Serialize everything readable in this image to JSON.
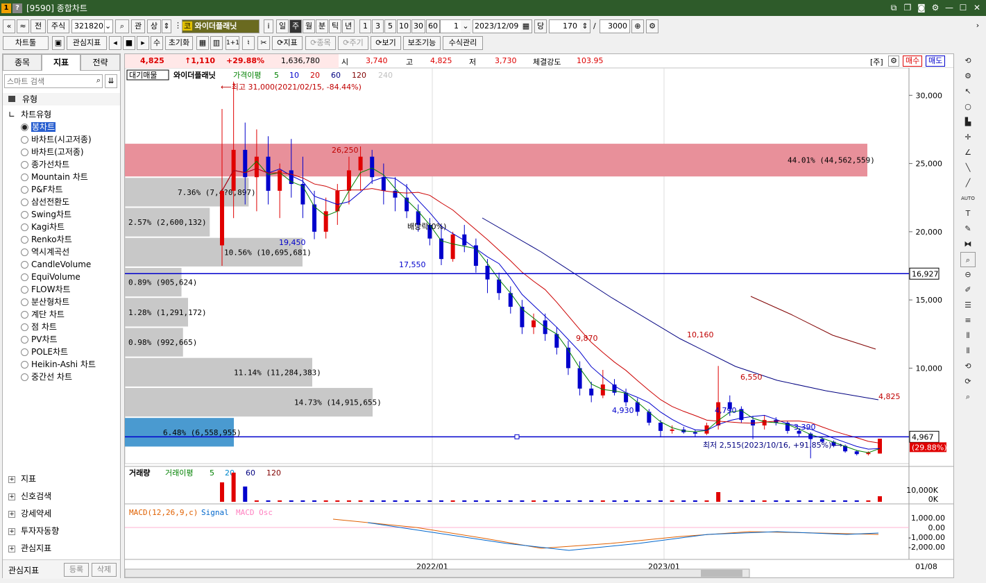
{
  "window": {
    "title": "[9590] 종합차트",
    "icons": [
      "gold-1-icon",
      "question-icon"
    ]
  },
  "toolbar1": {
    "nav_first": "«",
    "nav_up": "≈",
    "prev_label": "전",
    "type_label": "주식",
    "code": "321820",
    "search": "⌕",
    "gwan": "관",
    "sang": "상",
    "market_badge": "코",
    "stock_name": "와이더플래닛",
    "info": "i",
    "periods": [
      "일",
      "주",
      "월",
      "분",
      "틱",
      "년"
    ],
    "active_period": "주",
    "intervals": [
      "1",
      "3",
      "5",
      "10",
      "30",
      "60"
    ],
    "interval_value": "1",
    "date": "2023/12/09",
    "dang": "당",
    "count": "170",
    "slash": "/",
    "max": "3000"
  },
  "toolbar2": {
    "chart_tool": "차트툴",
    "watch_indicator": "관심지표",
    "su": "수",
    "reset": "초기화",
    "one_plus_one": "1+1",
    "indicator": "지표",
    "item": "종목",
    "period": "주기",
    "view": "보기",
    "sub_func": "보조기능",
    "formula": "수식관리"
  },
  "left_panel": {
    "tabs": [
      "종목",
      "지표",
      "전략"
    ],
    "active_tab": "지표",
    "search_placeholder": "스마트 검색",
    "group_label": "유형",
    "subgroup_label": "차트유형",
    "chart_types": [
      "봉차트",
      "바차트(시고저종)",
      "바차트(고저종)",
      "종가선차트",
      "Mountain 차트",
      "P&F차트",
      "삼선전환도",
      "Swing차트",
      "Kagi차트",
      "Renko차트",
      "역시계곡선",
      "CandleVolume",
      "EquiVolume",
      "FLOW차트",
      "분산형차트",
      "계단 차트",
      "점 차트",
      "PV차트",
      "POLE차트",
      "Heikin-Ashi 차트",
      "중간선 차트"
    ],
    "selected_type": "봉차트",
    "bottom_items": [
      "지표",
      "신호검색",
      "강세약세",
      "투자자동향",
      "관심지표"
    ],
    "footer_label": "관심지표",
    "register": "등록",
    "delete": "삭제"
  },
  "price_bar": {
    "price": "4,825",
    "change": "↑1,110",
    "pct": "+29.88%",
    "volume": "1,636,780",
    "open_label": "시",
    "open": "3,740",
    "high_label": "고",
    "high": "4,825",
    "low_label": "저",
    "low": "3,730",
    "strength_label": "체결강도",
    "strength": "103.95",
    "ju": "[주]",
    "buy": "매수",
    "sell": "매도"
  },
  "chart_data": {
    "type": "candlestick",
    "legend_main": {
      "vol_profile": "대기매물",
      "name": "와이더플래닛",
      "ma_label": "가격이평",
      "ma": [
        "5",
        "10",
        "20",
        "60",
        "120",
        "240"
      ],
      "ma_colors": [
        "#008000",
        "#0000cc",
        "#cc0000",
        "#000080",
        "#800000",
        "#c0c0c0"
      ]
    },
    "y_ticks": [
      10000,
      15000,
      20000,
      25000,
      30000
    ],
    "y_tick_labels": [
      "10,000",
      "15,000",
      "20,000",
      "25,000",
      "30,000"
    ],
    "ylim": [
      3000,
      32000
    ],
    "x_ticks": [
      "2022/01",
      "2023/01",
      "01/08"
    ],
    "annotations": {
      "max": "⟵최고 31,000(2021/02/15, -84.44%)",
      "min": "최저 2,515(2023/10/16, +91.85%)⟶",
      "dividend": "배당락(0%)",
      "points": [
        "26,250",
        "19,450",
        "17,550",
        "9,870",
        "4,930",
        "10,160",
        "4,790",
        "6,550",
        "3,390",
        "4,825"
      ]
    },
    "hlines": [
      {
        "value": 16927,
        "label": "16,927"
      },
      {
        "value": 4967,
        "label": "4,967",
        "sub": "(29.88%)"
      }
    ],
    "volume_profile": [
      {
        "price_lo": 24000,
        "price_hi": 26500,
        "label": "44.01% (44,562,559)",
        "share": 44.01
      },
      {
        "price_lo": 21800,
        "price_hi": 24000,
        "label": "7.36% (7,4?0,897)",
        "share": 7.36
      },
      {
        "price_lo": 19600,
        "price_hi": 21800,
        "label": "2.57% (2,600,132)",
        "share": 2.57
      },
      {
        "price_lo": 17400,
        "price_hi": 19600,
        "label": "10.56% (10,695,681)",
        "share": 10.56
      },
      {
        "price_lo": 15200,
        "price_hi": 17400,
        "label": "0.89% (905,624)",
        "share": 0.89
      },
      {
        "price_lo": 13000,
        "price_hi": 15200,
        "label": "1.28% (1,291,172)",
        "share": 1.28
      },
      {
        "price_lo": 10800,
        "price_hi": 13000,
        "label": "0.98% (992,665)",
        "share": 0.98
      },
      {
        "price_lo": 8600,
        "price_hi": 10800,
        "label": "11.14% (11,284,383)",
        "share": 11.14
      },
      {
        "price_lo": 6400,
        "price_hi": 8600,
        "label": "14.73% (14,915,655)",
        "share": 14.73
      },
      {
        "price_lo": 4200,
        "price_hi": 6400,
        "label": "6.48% (6,558,955)",
        "share": 6.48
      }
    ],
    "ohlc_weekly": [
      [
        19000,
        29000,
        17500,
        23000
      ],
      [
        23000,
        31000,
        21000,
        26000
      ],
      [
        26000,
        28000,
        22000,
        24000
      ],
      [
        24000,
        27500,
        21500,
        25500
      ],
      [
        25500,
        27000,
        22000,
        23000
      ],
      [
        23000,
        25000,
        21000,
        24500
      ],
      [
        24500,
        26800,
        22500,
        23500
      ],
      [
        23500,
        25500,
        21000,
        22000
      ],
      [
        22000,
        23000,
        19450,
        20000
      ],
      [
        20000,
        22500,
        19500,
        21500
      ],
      [
        21500,
        23500,
        20500,
        23000
      ],
      [
        23000,
        25500,
        22000,
        24500
      ],
      [
        24500,
        26250,
        23000,
        25500
      ],
      [
        25500,
        26000,
        23500,
        24000
      ],
      [
        24000,
        25000,
        22000,
        23000
      ],
      [
        23000,
        24000,
        21500,
        22500
      ],
      [
        22500,
        23500,
        21000,
        21500
      ],
      [
        21500,
        22000,
        20000,
        20500
      ],
      [
        20500,
        21000,
        19000,
        19500
      ],
      [
        19500,
        20500,
        17550,
        18000
      ],
      [
        18000,
        20000,
        17800,
        19800
      ],
      [
        19800,
        20500,
        18500,
        19000
      ],
      [
        19000,
        19500,
        17000,
        17500
      ],
      [
        17500,
        18000,
        15500,
        16500
      ],
      [
        16500,
        17000,
        15000,
        15500
      ],
      [
        15500,
        16000,
        14000,
        14500
      ],
      [
        14500,
        15000,
        12500,
        13000
      ],
      [
        13000,
        14000,
        12500,
        13500
      ],
      [
        13500,
        14000,
        12000,
        12500
      ],
      [
        12500,
        13000,
        11000,
        11500
      ],
      [
        11500,
        12000,
        9500,
        10000
      ],
      [
        10000,
        10500,
        8000,
        8500
      ],
      [
        8500,
        9000,
        7500,
        8000
      ],
      [
        8000,
        9870,
        7800,
        8800
      ],
      [
        8800,
        9200,
        8000,
        8200
      ],
      [
        8200,
        8500,
        7200,
        7500
      ],
      [
        7500,
        7800,
        6500,
        6800
      ],
      [
        6800,
        7000,
        5800,
        6000
      ],
      [
        6000,
        6200,
        4930,
        5400
      ],
      [
        5400,
        5800,
        5200,
        5500
      ],
      [
        5500,
        5700,
        5200,
        5300
      ],
      [
        5300,
        5500,
        5000,
        5200
      ],
      [
        5200,
        6000,
        5100,
        5800
      ],
      [
        5800,
        10160,
        5500,
        7500
      ],
      [
        7500,
        8000,
        6500,
        7000
      ],
      [
        7000,
        7200,
        6000,
        6200
      ],
      [
        6200,
        6500,
        4790,
        5800
      ],
      [
        5800,
        6550,
        5500,
        6200
      ],
      [
        6200,
        6400,
        5800,
        6000
      ],
      [
        6000,
        6100,
        5200,
        5400
      ],
      [
        5400,
        5600,
        5000,
        5200
      ],
      [
        5200,
        5300,
        3390,
        4800
      ],
      [
        4800,
        5000,
        4500,
        4600
      ],
      [
        4600,
        4700,
        4200,
        4300
      ],
      [
        4300,
        4400,
        3800,
        3900
      ],
      [
        3900,
        4000,
        3600,
        3700
      ],
      [
        3700,
        3900,
        3600,
        3800
      ],
      [
        3740,
        4825,
        3730,
        4825
      ]
    ],
    "volume": {
      "legend": "거래량",
      "ma_label": "거래이평",
      "ma": [
        "5",
        "20",
        "60",
        "120"
      ],
      "y_ticks": [
        "10,000K",
        "0K"
      ]
    },
    "macd": {
      "legend_macd": "MACD(12,26,9,c)",
      "legend_signal": "Signal",
      "legend_osc": "MACD Osc",
      "y_ticks": [
        "1,000.00",
        "0.00",
        "-1,000.00",
        "-2,000.00"
      ]
    }
  }
}
